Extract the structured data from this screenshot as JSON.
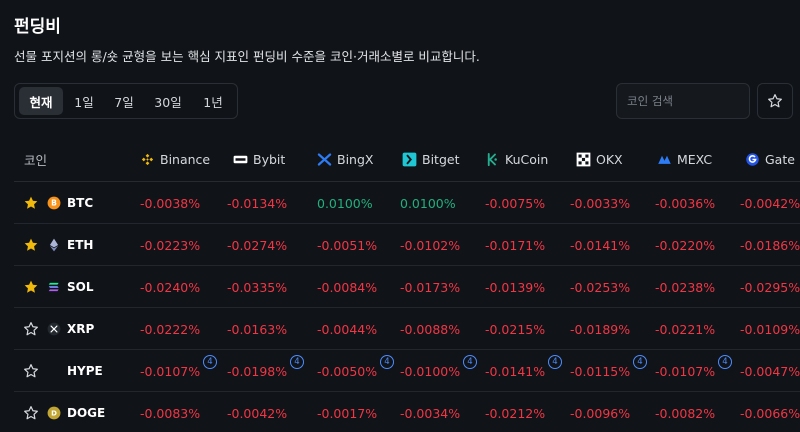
{
  "header": {
    "title": "펀딩비",
    "subtitle": "선물 포지션의 롱/숏 균형을 보는 핵심 지표인 펀딩비 수준을 코인·거래소별로 비교합니다."
  },
  "periods": [
    "현재",
    "1일",
    "7일",
    "30일",
    "1년"
  ],
  "active_period": "현재",
  "search": {
    "placeholder": "코인 검색"
  },
  "table": {
    "coin_header": "코인",
    "exchanges": [
      "Binance",
      "Bybit",
      "BingX",
      "Bitget",
      "KuCoin",
      "OKX",
      "MEXC",
      "Gate"
    ],
    "rows": [
      {
        "coin": "BTC",
        "favorite": true,
        "badge": "",
        "rates": [
          "-0.0038%",
          "-0.0134%",
          "0.0100%",
          "0.0100%",
          "-0.0075%",
          "-0.0033%",
          "-0.0036%",
          "-0.0042%"
        ]
      },
      {
        "coin": "ETH",
        "favorite": true,
        "badge": "",
        "rates": [
          "-0.0223%",
          "-0.0274%",
          "-0.0051%",
          "-0.0102%",
          "-0.0171%",
          "-0.0141%",
          "-0.0220%",
          "-0.0186%"
        ]
      },
      {
        "coin": "SOL",
        "favorite": true,
        "badge": "",
        "rates": [
          "-0.0240%",
          "-0.0335%",
          "-0.0084%",
          "-0.0173%",
          "-0.0139%",
          "-0.0253%",
          "-0.0238%",
          "-0.0295%"
        ]
      },
      {
        "coin": "XRP",
        "favorite": false,
        "badge": "",
        "rates": [
          "-0.0222%",
          "-0.0163%",
          "-0.0044%",
          "-0.0088%",
          "-0.0215%",
          "-0.0189%",
          "-0.0221%",
          "-0.0109%"
        ]
      },
      {
        "coin": "HYPE",
        "favorite": false,
        "badge": "4",
        "rates": [
          "-0.0107%",
          "-0.0198%",
          "-0.0050%",
          "-0.0100%",
          "-0.0141%",
          "-0.0115%",
          "-0.0107%",
          "-0.0047%"
        ]
      },
      {
        "coin": "DOGE",
        "favorite": false,
        "badge": "",
        "rates": [
          "-0.0083%",
          "-0.0042%",
          "-0.0017%",
          "-0.0034%",
          "-0.0212%",
          "-0.0096%",
          "-0.0082%",
          "-0.0066%"
        ]
      }
    ]
  },
  "colors": {
    "negative": "#f23645",
    "positive": "#22b07d",
    "star_active": "#f0b90b",
    "badge": "#4d8dff"
  },
  "icons": {
    "exchanges": [
      "binance-icon",
      "bybit-icon",
      "bingx-icon",
      "bitget-icon",
      "kucoin-icon",
      "okx-icon",
      "mexc-icon",
      "gate-icon"
    ],
    "coins": [
      "btc-icon",
      "eth-icon",
      "sol-icon",
      "xrp-icon",
      "hype-icon",
      "doge-icon"
    ]
  }
}
